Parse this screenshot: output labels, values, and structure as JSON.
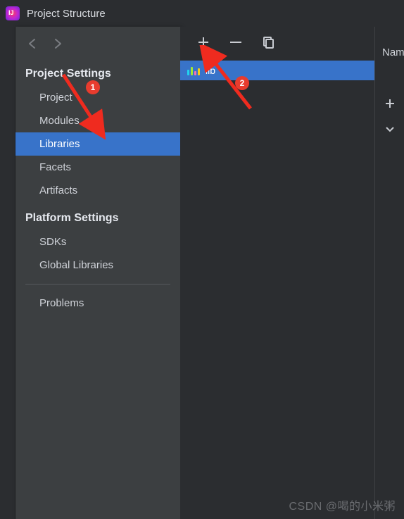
{
  "window": {
    "title": "Project Structure"
  },
  "sidebar": {
    "project_settings_header": "Project Settings",
    "items": [
      {
        "label": "Project"
      },
      {
        "label": "Modules"
      },
      {
        "label": "Libraries",
        "selected": true
      },
      {
        "label": "Facets"
      },
      {
        "label": "Artifacts"
      }
    ],
    "platform_settings_header": "Platform Settings",
    "platform_items": [
      {
        "label": "SDKs"
      },
      {
        "label": "Global Libraries"
      }
    ],
    "problems_label": "Problems"
  },
  "toolbar": {
    "add_label": "+",
    "remove_label": "−",
    "copy_label": "copy"
  },
  "library_list": {
    "items": [
      {
        "name": "lib"
      }
    ]
  },
  "right": {
    "name_label": "Nam",
    "add_label": "+",
    "expand_label": "v"
  },
  "annotations": {
    "badge1": "1",
    "badge2": "2"
  },
  "watermark": "CSDN @喝的小米粥"
}
